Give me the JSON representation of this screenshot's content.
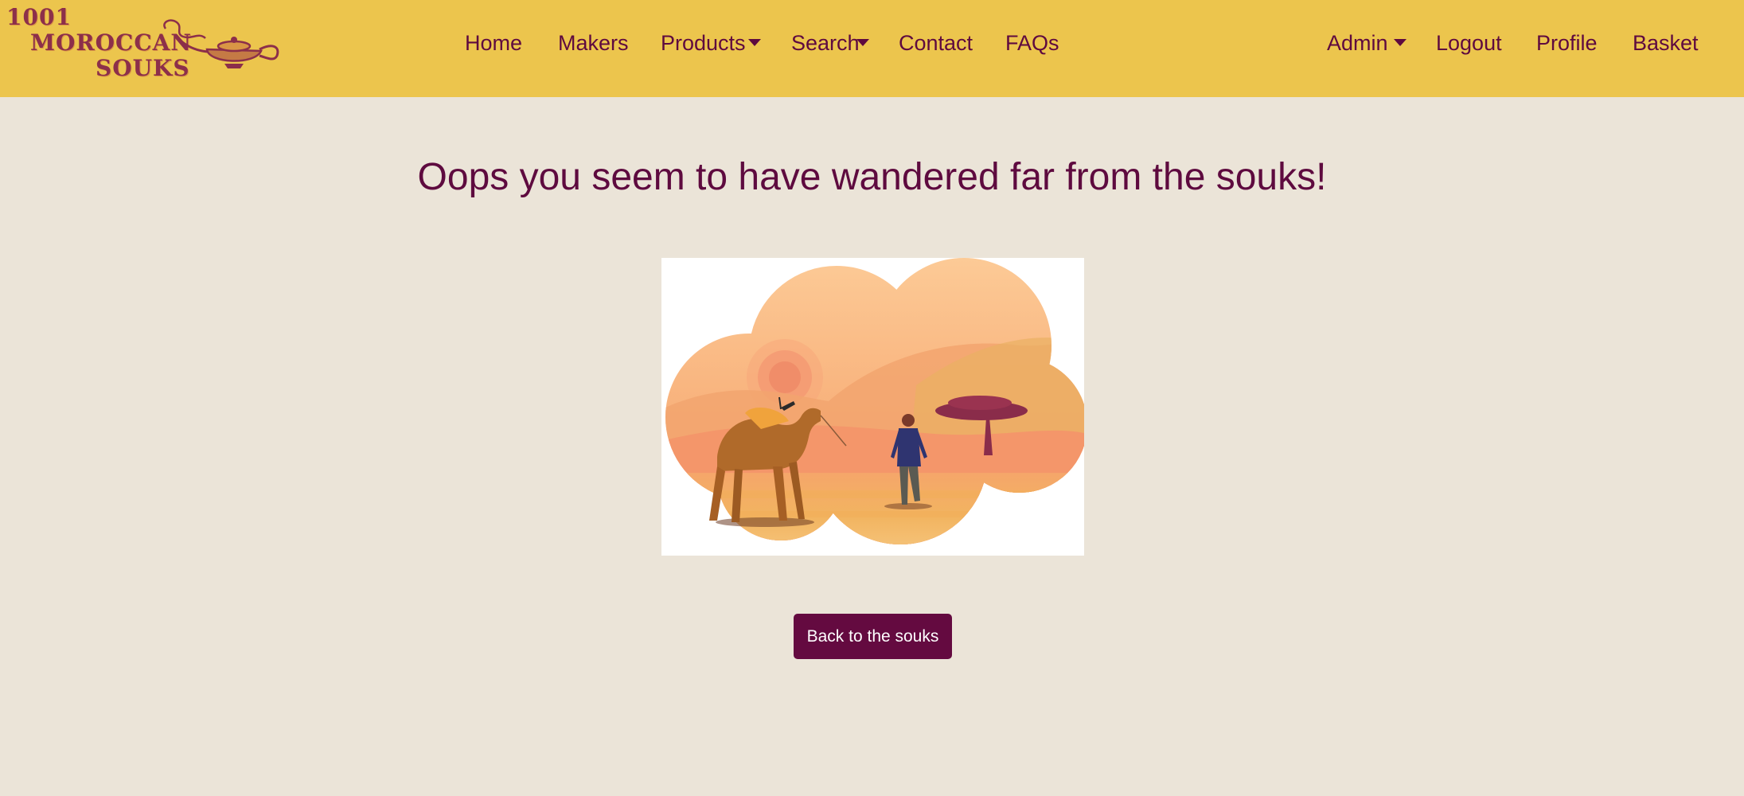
{
  "brand": {
    "logo_line1": "1001",
    "logo_line2": "MOROCCAN",
    "logo_line3": "SOUKS"
  },
  "nav": {
    "left": [
      "Home",
      "Makers",
      "Products",
      "Search",
      "Contact",
      "FAQs"
    ],
    "right": [
      "Admin",
      "Logout",
      "Profile",
      "Basket"
    ],
    "dropdowns": [
      "Products",
      "Search",
      "Admin"
    ]
  },
  "main": {
    "title": "Oops you seem to have wandered far from the souks!",
    "back_button": "Back to the souks"
  },
  "colors": {
    "navbar": "#ecc54d",
    "background": "#ebe4d8",
    "accent": "#5e0a3f",
    "button": "#640a40"
  }
}
